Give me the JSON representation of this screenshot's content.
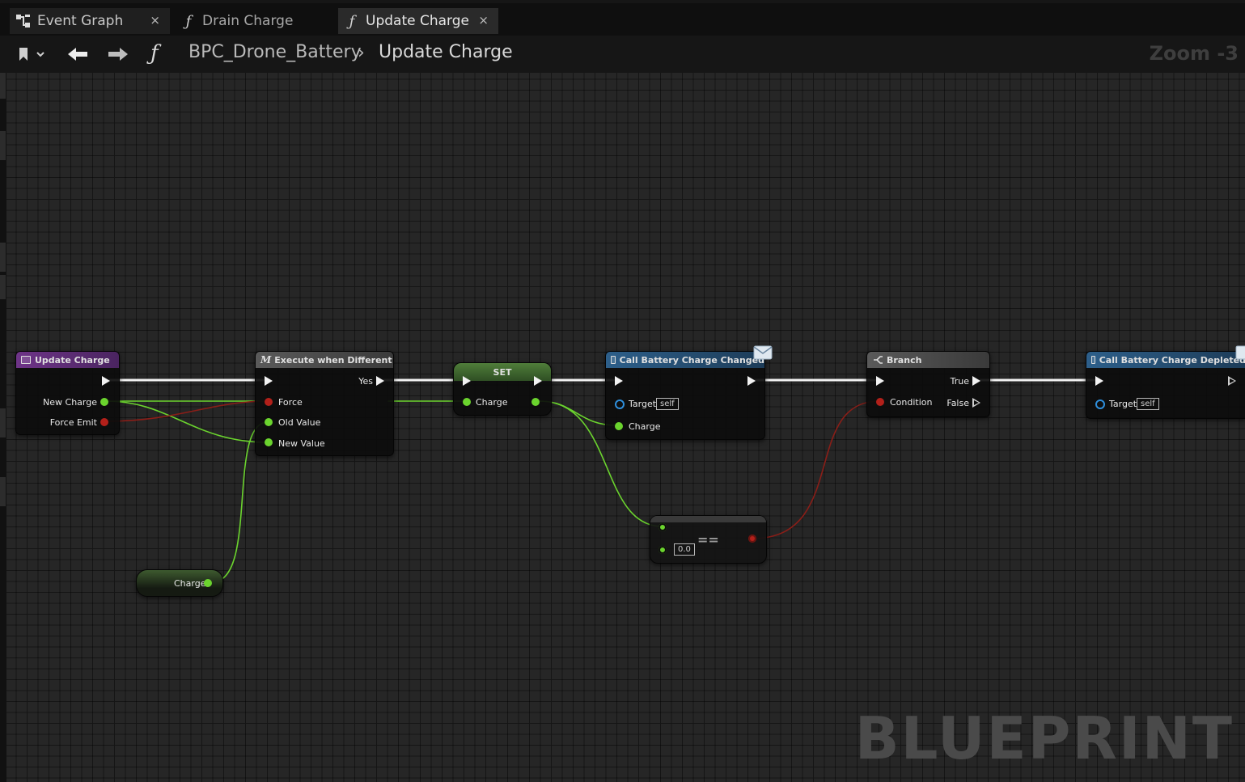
{
  "tabs": [
    {
      "label": "Event Graph",
      "icon": "event-graph-icon",
      "close": "×"
    },
    {
      "label": "Drain Charge",
      "icon": "function-icon",
      "glyph": "ƒ"
    },
    {
      "label": "Update Charge",
      "icon": "function-icon",
      "glyph": "ƒ",
      "close": "×"
    }
  ],
  "breadcrumb": {
    "glyph": "ƒ",
    "parent": "BPC_Drone_Battery",
    "separator": "›",
    "current": "Update Charge"
  },
  "zoom": "Zoom -3",
  "watermark": "BLUEPRINT",
  "colors": {
    "exec": "#f2f2f2",
    "float": "#6bd42e",
    "bool": "#b3201a",
    "object": "#2f8fdc",
    "function_header": "#5a2d74",
    "set_header": "#3f6a2e"
  },
  "nodes": {
    "entry": {
      "title": "Update Charge",
      "pins": {
        "new_charge": "New Charge",
        "force_emit": "Force Emit"
      }
    },
    "exec_diff": {
      "title": "Execute when Different",
      "glyph": "M",
      "pins": {
        "yes": "Yes",
        "force": "Force",
        "old_value": "Old Value",
        "new_value": "New Value"
      }
    },
    "set": {
      "title": "SET",
      "pins": {
        "charge": "Charge"
      }
    },
    "call_changed": {
      "title": "Call Battery Charge Changed",
      "pins": {
        "target": "Target",
        "self": "self",
        "charge": "Charge"
      }
    },
    "branch": {
      "title": "Branch",
      "pins": {
        "true": "True",
        "false": "False",
        "condition": "Condition"
      }
    },
    "call_depleted": {
      "title": "Call Battery Charge Depleted",
      "pins": {
        "target": "Target",
        "self": "self"
      }
    },
    "equal": {
      "label": "==",
      "value": "0.0"
    },
    "getter": {
      "label": "Charge"
    }
  }
}
